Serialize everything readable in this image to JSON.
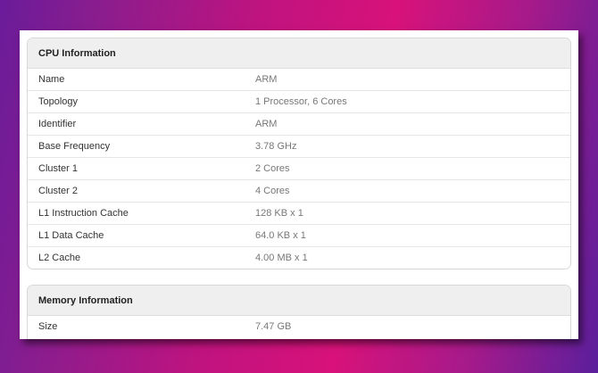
{
  "cpu": {
    "title": "CPU Information",
    "rows": [
      {
        "label": "Name",
        "value": "ARM"
      },
      {
        "label": "Topology",
        "value": "1 Processor, 6 Cores"
      },
      {
        "label": "Identifier",
        "value": "ARM"
      },
      {
        "label": "Base Frequency",
        "value": "3.78 GHz"
      },
      {
        "label": "Cluster 1",
        "value": "2 Cores"
      },
      {
        "label": "Cluster 2",
        "value": "4 Cores"
      },
      {
        "label": "L1 Instruction Cache",
        "value": "128 KB x 1"
      },
      {
        "label": "L1 Data Cache",
        "value": "64.0 KB x 1"
      },
      {
        "label": "L2 Cache",
        "value": "4.00 MB x 1"
      }
    ]
  },
  "memory": {
    "title": "Memory Information",
    "rows": [
      {
        "label": "Size",
        "value": "7.47 GB"
      }
    ]
  },
  "colors": {
    "background_gradient": [
      "#6a1c9a",
      "#d8127a",
      "#5b1f9c"
    ],
    "header_bg": "#efefef",
    "label_text": "#333333",
    "value_text": "#777777"
  }
}
